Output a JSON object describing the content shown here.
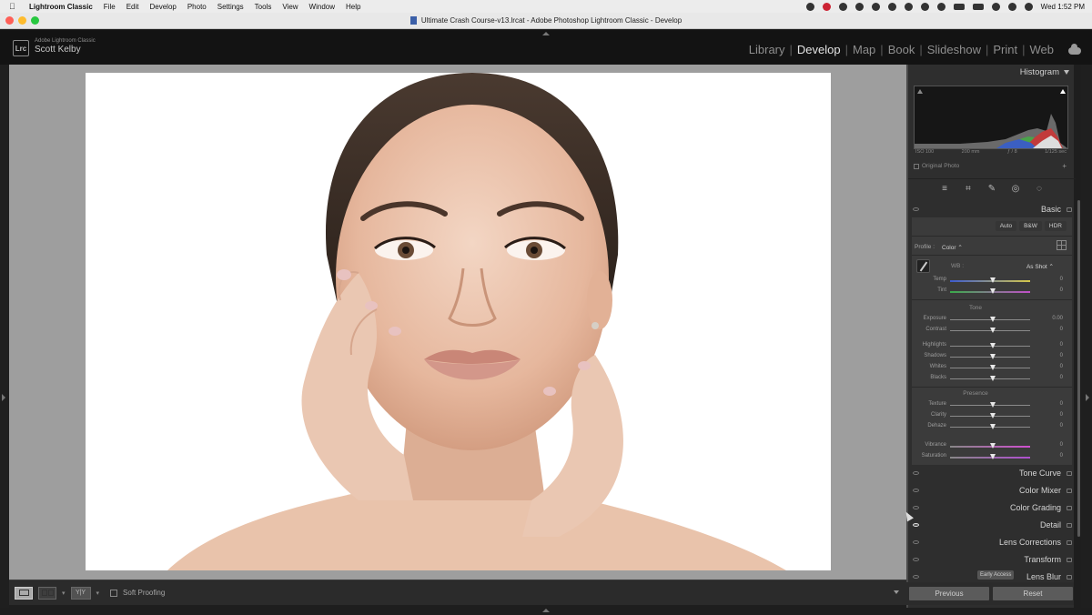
{
  "menubar": {
    "app_name": "Lightroom Classic",
    "items": [
      "File",
      "Edit",
      "Develop",
      "Photo",
      "Settings",
      "Tools",
      "View",
      "Window",
      "Help"
    ],
    "clock": "Wed 1:52 PM"
  },
  "window": {
    "title": "Ultimate Crash Course-v13.lrcat - Adobe Photoshop Lightroom Classic - Develop"
  },
  "identity": {
    "logo": "Lrc",
    "app": "Adobe Lightroom Classic",
    "user": "Scott Kelby"
  },
  "modules": [
    "Library",
    "Develop",
    "Map",
    "Book",
    "Slideshow",
    "Print",
    "Web"
  ],
  "active_module": "Develop",
  "histogram": {
    "title": "Histogram",
    "info": [
      "ISO 100",
      "200 mm",
      "ƒ / 8",
      "1/125 sec"
    ],
    "original_photo_label": "Original Photo"
  },
  "tools": [
    "adjust-icon",
    "crop-icon",
    "healing-icon",
    "redeye-icon",
    "masking-icon"
  ],
  "basic": {
    "title": "Basic",
    "modes": [
      "Auto",
      "B&W",
      "HDR"
    ],
    "profile_label": "Profile :",
    "profile_value": "Color",
    "wb_label": "WB :",
    "wb_value": "As Shot",
    "tone_label": "Tone",
    "presence_label": "Presence",
    "sliders": [
      {
        "name": "Temp",
        "value": "0",
        "group": "wb"
      },
      {
        "name": "Tint",
        "value": "0",
        "group": "wb"
      },
      {
        "name": "Exposure",
        "value": "0.00",
        "group": "tone"
      },
      {
        "name": "Contrast",
        "value": "0",
        "group": "tone"
      },
      {
        "name": "Highlights",
        "value": "0",
        "group": "tone2"
      },
      {
        "name": "Shadows",
        "value": "0",
        "group": "tone2"
      },
      {
        "name": "Whites",
        "value": "0",
        "group": "tone2"
      },
      {
        "name": "Blacks",
        "value": "0",
        "group": "tone2"
      },
      {
        "name": "Texture",
        "value": "0",
        "group": "presence"
      },
      {
        "name": "Clarity",
        "value": "0",
        "group": "presence"
      },
      {
        "name": "Dehaze",
        "value": "0",
        "group": "presence"
      },
      {
        "name": "Vibrance",
        "value": "0",
        "group": "presence2"
      },
      {
        "name": "Saturation",
        "value": "0",
        "group": "presence2"
      }
    ]
  },
  "panels": [
    "Tone Curve",
    "Color Mixer",
    "Color Grading",
    "Detail",
    "Lens Corrections",
    "Transform",
    "Lens Blur"
  ],
  "early_access_badge": "Early Access",
  "toolbar": {
    "soft_proofing": "Soft Proofing",
    "yy": "Y|Y"
  },
  "footer": {
    "previous": "Previous",
    "reset": "Reset"
  },
  "colors": {
    "panel_bg": "#2e2e2e",
    "canvas_bg": "#9e9e9e",
    "active_module": "#e4e4e4"
  }
}
